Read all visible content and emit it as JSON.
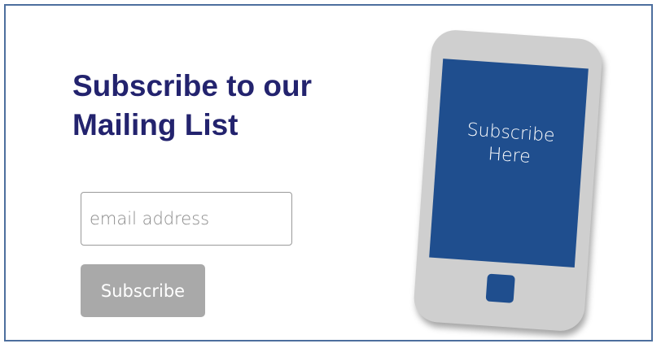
{
  "form": {
    "heading": "Subscribe to our Mailing List",
    "email_placeholder": "email address",
    "email_value": "",
    "button_label": "Subscribe"
  },
  "phone": {
    "screen_text": "Subscribe\nHere"
  },
  "colors": {
    "heading": "#23236e",
    "button_background": "#a9a9a9",
    "phone_screen": "#1f4e8e",
    "phone_body": "#cfcfcf",
    "frame_border": "#4d6f9e"
  }
}
